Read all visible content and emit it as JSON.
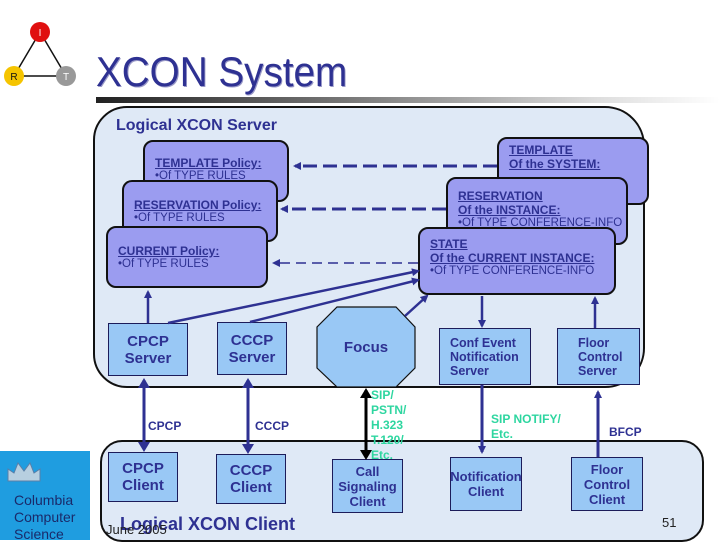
{
  "slide": {
    "title": "XCON System",
    "date": "June 2005",
    "page_number": "51"
  },
  "logo_irt": {
    "nodes": [
      "I",
      "R",
      "T"
    ],
    "colors": {
      "I": "#e01010",
      "R": "#f5c400",
      "T": "#999999"
    }
  },
  "logo_columbia": {
    "lines": [
      "Columbia",
      "Computer",
      "Science"
    ],
    "color": "#1f9de0"
  },
  "server": {
    "label": "Logical XCON Server",
    "policies": [
      {
        "title": "TEMPLATE  Policy:",
        "subtitle": "•Of TYPE RULES"
      },
      {
        "title": "RESERVATION Policy:",
        "subtitle": "•Of TYPE RULES"
      },
      {
        "title": "CURRENT Policy:",
        "subtitle": "•Of TYPE RULES"
      }
    ],
    "data_stores": [
      {
        "title": "TEMPLATE",
        "line2": "Of the SYSTEM:",
        "subtitle": ""
      },
      {
        "title": "RESERVATION",
        "line2": "Of the INSTANCE:",
        "subtitle": "•Of TYPE CONFERENCE-INFO"
      },
      {
        "title": "STATE",
        "line2": "Of the CURRENT INSTANCE:",
        "subtitle": "•Of TYPE CONFERENCE-INFO"
      }
    ],
    "components": {
      "cpcp_server": [
        "CPCP",
        "Server"
      ],
      "cccp_server": [
        "CCCP",
        "Server"
      ],
      "focus": "Focus",
      "conf_event": [
        "Conf  Event",
        "Notification",
        "Server"
      ],
      "floor_control": [
        "Floor",
        "Control",
        "Server"
      ]
    }
  },
  "protocols": {
    "cpcp": "CPCP",
    "cccp": "CCCP",
    "signaling": [
      "SIP/",
      "PSTN/",
      "H.323",
      "T.120/",
      "Etc."
    ],
    "notify": [
      "SIP NOTIFY/",
      "Etc."
    ],
    "bfcp": "BFCP"
  },
  "client": {
    "label": "Logical XCON Client",
    "components": {
      "cpcp_client": [
        "CPCP",
        "Client"
      ],
      "cccp_client": [
        "CCCP",
        "Client"
      ],
      "call_signaling": [
        "Call",
        "Signaling",
        "Client"
      ],
      "notification": [
        "Notification",
        "Client"
      ],
      "floor_control": [
        "Floor",
        "Control",
        "Client"
      ]
    }
  },
  "colors": {
    "title": "#2e3192",
    "policy_fill": "#9b9cf0",
    "box_fill": "#99c8f5",
    "container_fill": "#dfe9f6",
    "arrow": "#2e3192",
    "protocol_green": "#2ed6a0"
  }
}
